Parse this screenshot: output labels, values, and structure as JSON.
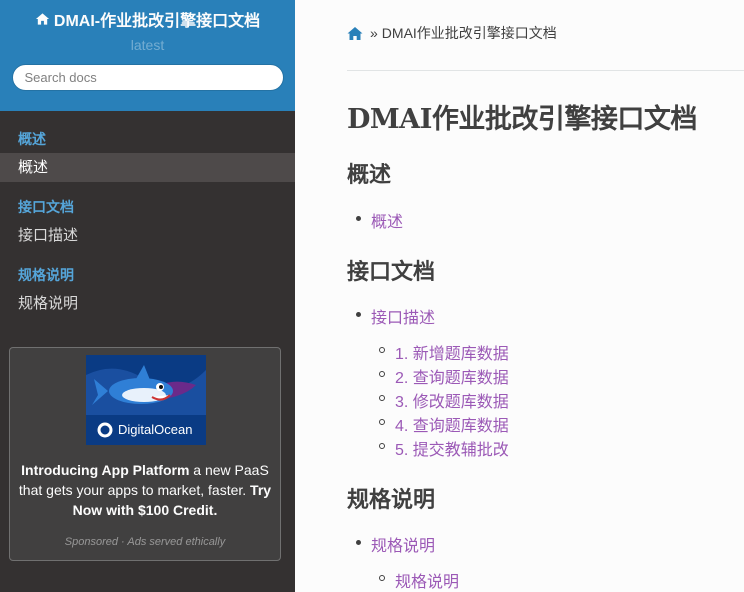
{
  "sidebar": {
    "project_title": "DMAI-作业批改引擎接口文档",
    "version": "latest",
    "search_placeholder": "Search docs",
    "sections": [
      {
        "caption": "概述",
        "items": [
          {
            "label": "概述",
            "current": true
          }
        ]
      },
      {
        "caption": "接口文档",
        "items": [
          {
            "label": "接口描述",
            "current": false
          }
        ]
      },
      {
        "caption": "规格说明",
        "items": [
          {
            "label": "规格说明",
            "current": false
          }
        ]
      }
    ],
    "ad": {
      "image_brand": "DigitalOcean",
      "headline": "Introducing App Platform",
      "body": " a new PaaS that gets your apps to market, faster. ",
      "cta": "Try Now with $100 Credit.",
      "footer": "Sponsored · Ads served ethically"
    }
  },
  "breadcrumb": {
    "separator": "»",
    "current": "DMAI作业批改引擎接口文档"
  },
  "main": {
    "title": "DMAI作业批改引擎接口文档",
    "sections": [
      {
        "heading": "概述",
        "links": [
          {
            "label": "概述",
            "children": []
          }
        ]
      },
      {
        "heading": "接口文档",
        "links": [
          {
            "label": "接口描述",
            "children": [
              "1. 新增题库数据",
              "2. 查询题库数据",
              "3. 修改题库数据",
              "4. 查询题库数据",
              "5. 提交教辅批改"
            ]
          }
        ]
      },
      {
        "heading": "规格说明",
        "links": [
          {
            "label": "规格说明",
            "children": [
              "规格说明"
            ]
          }
        ]
      }
    ]
  },
  "colors": {
    "sidebar_top": "#2980b9",
    "sidebar_bg": "#343131",
    "caption": "#55a5d9",
    "link": "#9b59b6",
    "text": "#404040"
  }
}
